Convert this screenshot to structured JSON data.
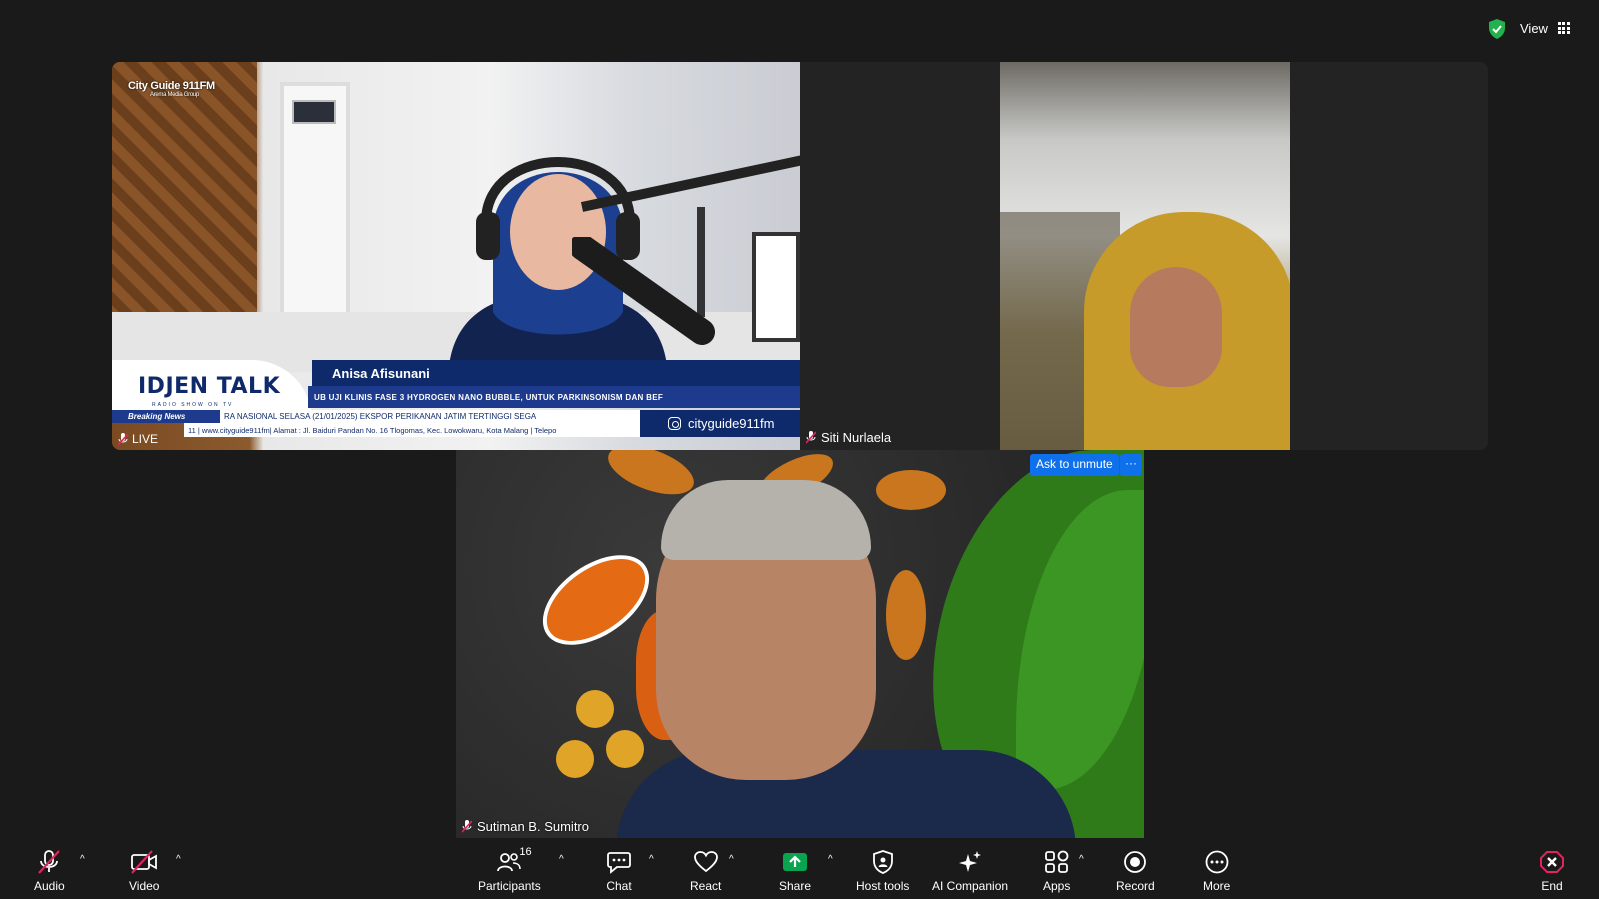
{
  "topbar": {
    "view_label": "View"
  },
  "tiles": {
    "studio": {
      "logo_name": "City Guide 911FM",
      "logo_sub": "Arema Media Group",
      "show_title": "IDJEN TALK",
      "show_sub": "RADIO SHOW ON TV",
      "host_name": "Anisa Afisunani",
      "headline": "UB UJI KLINIS FASE 3 HYDROGEN NANO BUBBLE, UNTUK PARKINSONISM DAN BEF",
      "breaking_label": "Breaking News",
      "ticker_1": "RA NASIONAL   SELASA (21/01/2025) EKSPOR PERIKANAN JATIM TERTINGGI SEGA",
      "ticker_2": "11 | www.cityguide911fm| Alamat : Jl. Baiduri Pandan No. 16 Tlogomas, Kec. Lowokwaru, Kota Malang | Telepo",
      "instagram": "cityguide911fm",
      "live_label": "LIVE"
    },
    "siti": {
      "name": "Siti Nurlaela"
    },
    "sutiman": {
      "name": "Sutiman B. Sumitro",
      "ask_unmute": "Ask to unmute",
      "more_mini": "···"
    }
  },
  "toolbar": {
    "audio": "Audio",
    "video": "Video",
    "participants": "Participants",
    "participants_count": "16",
    "chat": "Chat",
    "react": "React",
    "share": "Share",
    "host_tools": "Host tools",
    "ai_companion": "AI Companion",
    "apps": "Apps",
    "record": "Record",
    "more": "More",
    "end": "End"
  },
  "colors": {
    "share_green": "#0aa34f",
    "end_red": "#e0245e",
    "unmute_blue": "#0e71eb",
    "muted_red": "#e0245e"
  }
}
